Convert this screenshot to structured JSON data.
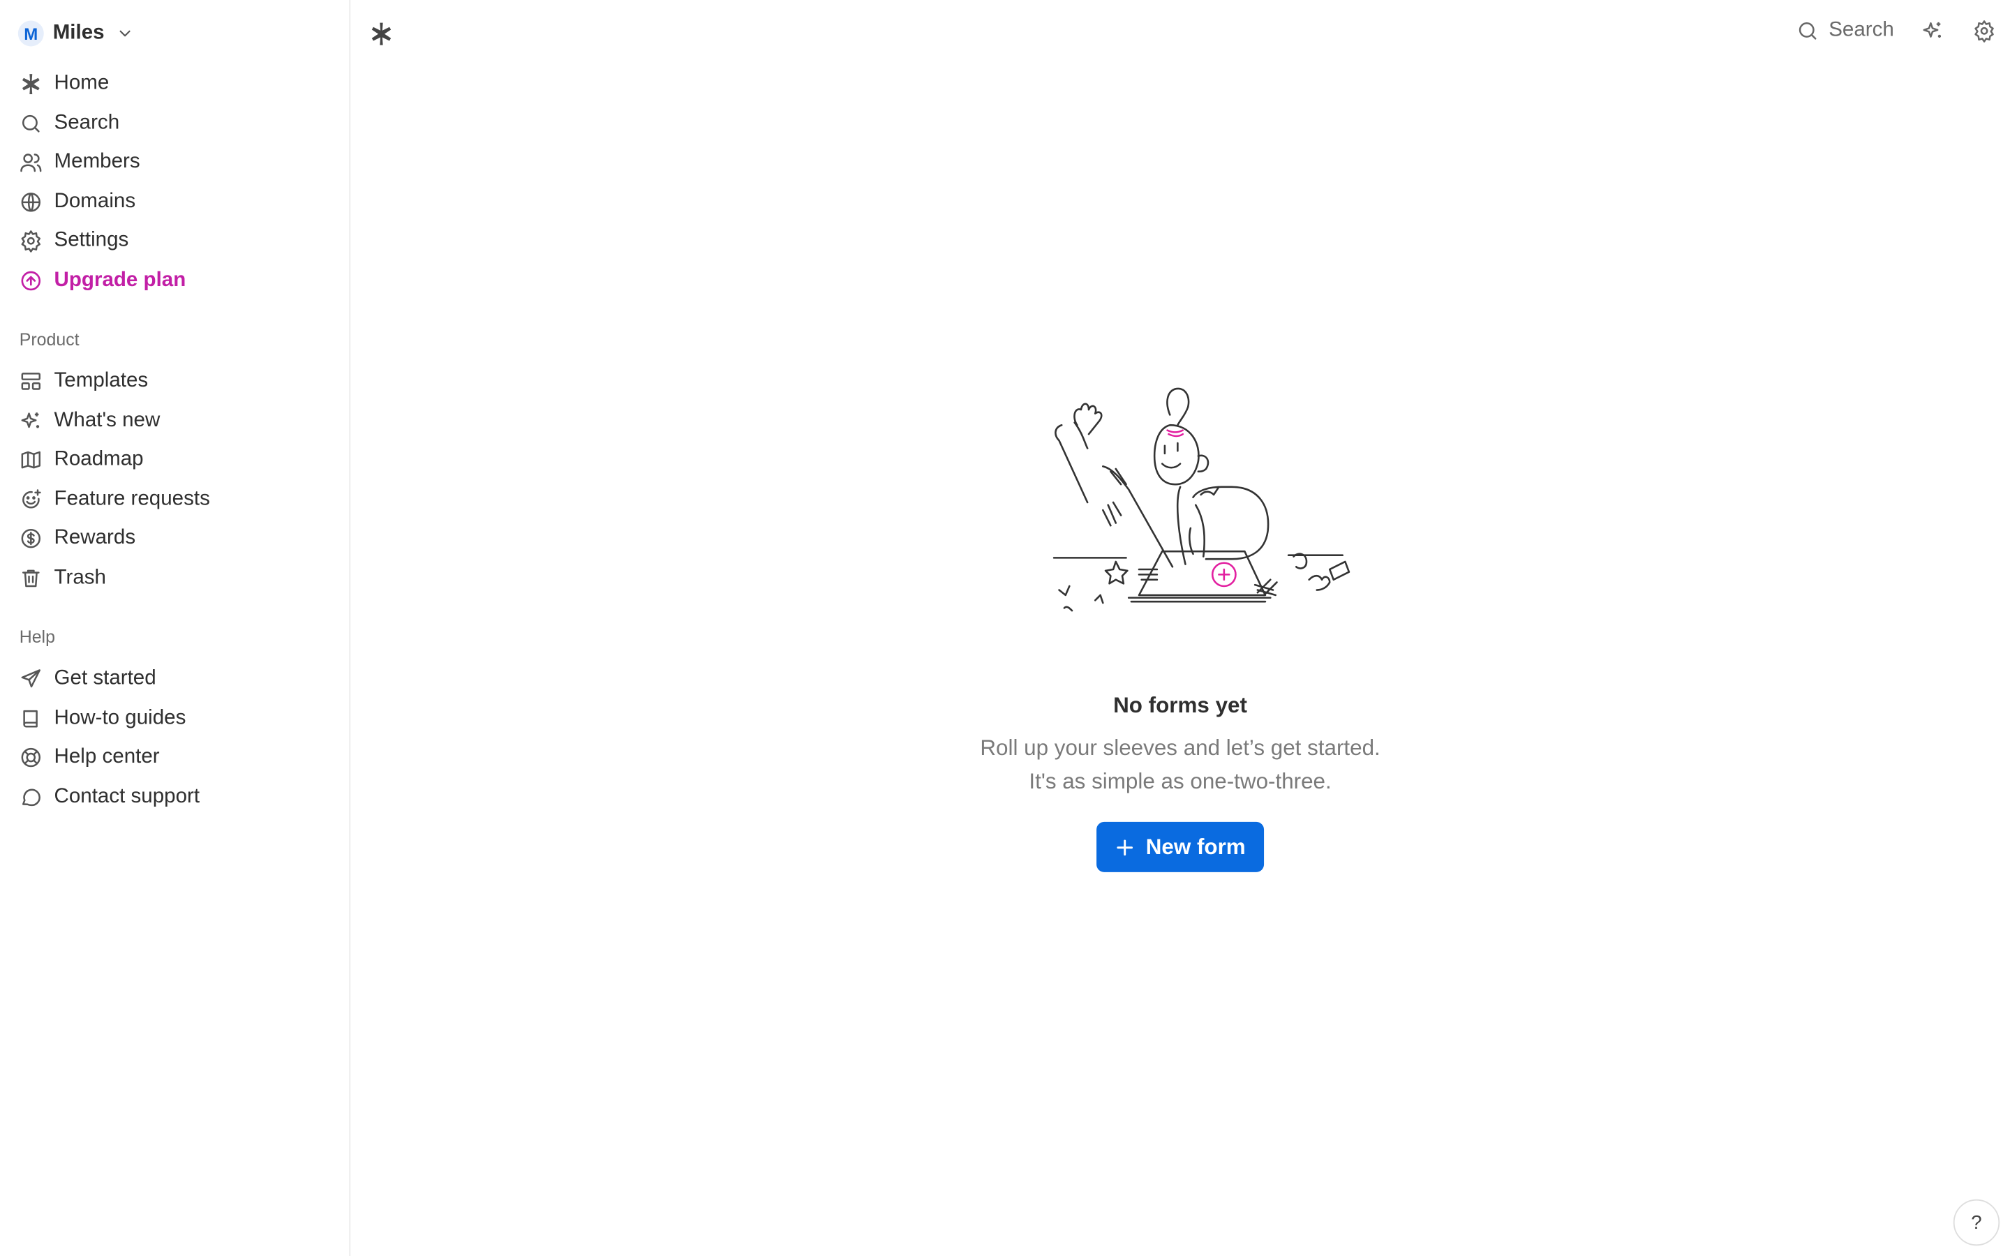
{
  "workspace": {
    "initial": "M",
    "name": "Miles",
    "icon": "chevron-down-icon"
  },
  "sidebar": {
    "main_items": [
      {
        "label": "Home",
        "icon": "asterisk-icon"
      },
      {
        "label": "Search",
        "icon": "search-icon"
      },
      {
        "label": "Members",
        "icon": "users-icon"
      },
      {
        "label": "Domains",
        "icon": "globe-icon"
      },
      {
        "label": "Settings",
        "icon": "gear-icon"
      },
      {
        "label": "Upgrade plan",
        "icon": "arrow-up-circle-icon",
        "color": "#c21fa6"
      }
    ],
    "product_label": "Product",
    "product_items": [
      {
        "label": "Templates",
        "icon": "layout-icon"
      },
      {
        "label": "What's new",
        "icon": "sparkles-icon"
      },
      {
        "label": "Roadmap",
        "icon": "map-icon"
      },
      {
        "label": "Feature requests",
        "icon": "smile-plus-icon"
      },
      {
        "label": "Rewards",
        "icon": "dollar-circle-icon"
      },
      {
        "label": "Trash",
        "icon": "trash-icon"
      }
    ],
    "help_label": "Help",
    "help_items": [
      {
        "label": "Get started",
        "icon": "send-icon"
      },
      {
        "label": "How-to guides",
        "icon": "book-icon"
      },
      {
        "label": "Help center",
        "icon": "lifebuoy-icon"
      },
      {
        "label": "Contact support",
        "icon": "chat-bubble-icon"
      }
    ]
  },
  "topbar": {
    "search_label": "Search"
  },
  "empty_state": {
    "title": "No forms yet",
    "line1": "Roll up your sleeves and let’s get started.",
    "line2": "It's as simple as one-two-three.",
    "button_label": "New form"
  },
  "help_button": "?",
  "colors": {
    "accent": "#0a6be0",
    "upgrade": "#c21fa6",
    "illustration_accent": "#e21fa0"
  }
}
